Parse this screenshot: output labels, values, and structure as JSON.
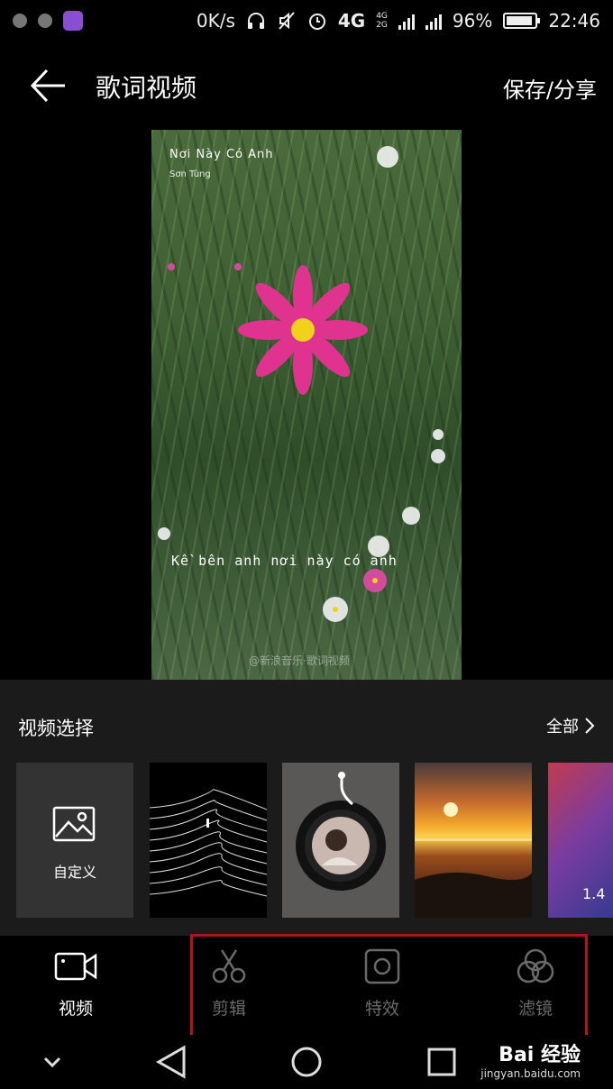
{
  "status_bar": {
    "network_speed": "0K/s",
    "network_type": "4G",
    "sim1_type": "4G",
    "sim2_type": "2G",
    "battery": "96%",
    "time": "22:46"
  },
  "header": {
    "title": "歌词视频",
    "save_share": "保存/分享"
  },
  "video": {
    "song_title": "Nơi Này Có Anh",
    "artist": "Sơn Tùng",
    "lyric": "Kề bên anh nơi này có anh",
    "watermark": "@新浪音乐·歌词视频"
  },
  "video_select": {
    "title": "视频选择",
    "all_label": "全部",
    "custom_label": "自定义",
    "partial_thumb_label": "1.4"
  },
  "tabs": [
    {
      "label": "视频",
      "icon": "video-camera-icon",
      "active": true
    },
    {
      "label": "剪辑",
      "icon": "scissors-icon",
      "active": false
    },
    {
      "label": "特效",
      "icon": "effects-square-icon",
      "active": false
    },
    {
      "label": "滤镜",
      "icon": "filter-circles-icon",
      "active": false
    }
  ],
  "watermark": {
    "brand": "Bai 经验",
    "url": "jingyan.baidu.com"
  },
  "colors": {
    "highlight_border": "#b3121f",
    "panel_bg": "#1b1b1b",
    "inactive_tab": "#6a6a6a"
  }
}
